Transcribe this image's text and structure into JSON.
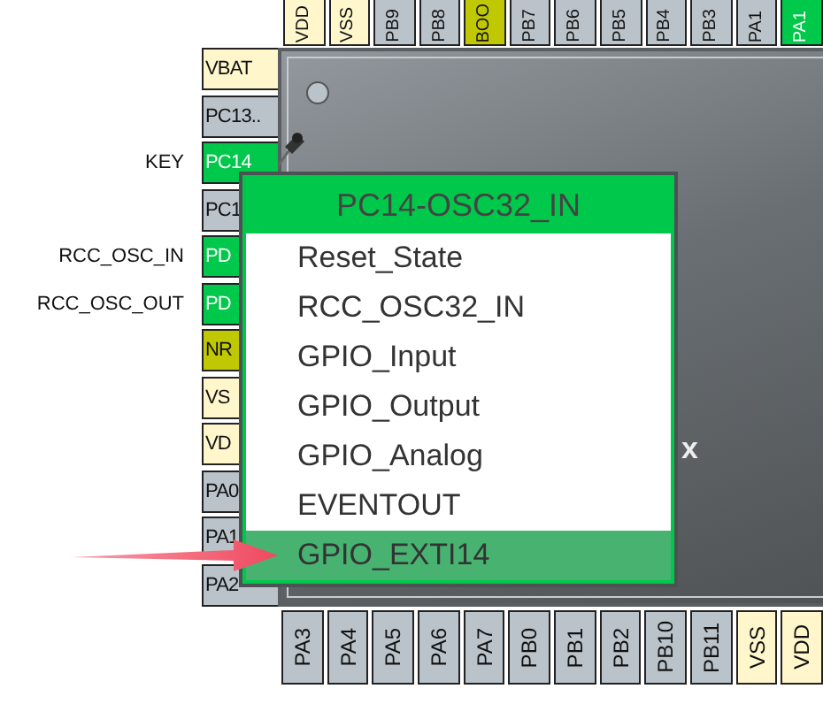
{
  "top_pins": [
    {
      "label": "VDD",
      "kind": "power"
    },
    {
      "label": "VSS",
      "kind": "power"
    },
    {
      "label": "PB9",
      "kind": "free"
    },
    {
      "label": "PB8",
      "kind": "free"
    },
    {
      "label": "BOO",
      "kind": "fixed"
    },
    {
      "label": "PB7",
      "kind": "free"
    },
    {
      "label": "PB6",
      "kind": "free"
    },
    {
      "label": "PB5",
      "kind": "free"
    },
    {
      "label": "PB4",
      "kind": "free"
    },
    {
      "label": "PB3",
      "kind": "free"
    },
    {
      "label": "PA1",
      "kind": "free"
    },
    {
      "label": "PA1",
      "kind": "assigned"
    }
  ],
  "left_pins": [
    {
      "label": "VBAT",
      "kind": "power"
    },
    {
      "label": "PC13..",
      "kind": "free"
    },
    {
      "label": "PC14",
      "kind": "assigned",
      "signal": "KEY"
    },
    {
      "label": "PC1",
      "kind": "free"
    },
    {
      "label": "PD",
      "kind": "assigned",
      "signal": "RCC_OSC_IN"
    },
    {
      "label": "PD",
      "kind": "assigned",
      "signal": "RCC_OSC_OUT"
    },
    {
      "label": "NR",
      "kind": "fixed"
    },
    {
      "label": "VS",
      "kind": "power"
    },
    {
      "label": "VD",
      "kind": "power"
    },
    {
      "label": "PA0",
      "kind": "free"
    },
    {
      "label": "PA1",
      "kind": "free"
    },
    {
      "label": "PA2",
      "kind": "free"
    }
  ],
  "chip": {
    "label": "x"
  },
  "bottom_pins": [
    {
      "label": "PA3",
      "kind": "free"
    },
    {
      "label": "PA4",
      "kind": "free"
    },
    {
      "label": "PA5",
      "kind": "free"
    },
    {
      "label": "PA6",
      "kind": "free"
    },
    {
      "label": "PA7",
      "kind": "free"
    },
    {
      "label": "PB0",
      "kind": "free"
    },
    {
      "label": "PB1",
      "kind": "free"
    },
    {
      "label": "PB2",
      "kind": "free"
    },
    {
      "label": "PB10",
      "kind": "free"
    },
    {
      "label": "PB11",
      "kind": "free"
    },
    {
      "label": "VSS",
      "kind": "power"
    },
    {
      "label": "VDD",
      "kind": "power"
    }
  ],
  "context_menu": {
    "title": "PC14-OSC32_IN",
    "items": [
      {
        "label": "Reset_State",
        "selected": false
      },
      {
        "label": "RCC_OSC32_IN",
        "selected": false
      },
      {
        "label": "GPIO_Input",
        "selected": false
      },
      {
        "label": "GPIO_Output",
        "selected": false
      },
      {
        "label": "GPIO_Analog",
        "selected": false
      },
      {
        "label": "EVENTOUT",
        "selected": false
      },
      {
        "label": "GPIO_EXTI14",
        "selected": true
      }
    ]
  }
}
